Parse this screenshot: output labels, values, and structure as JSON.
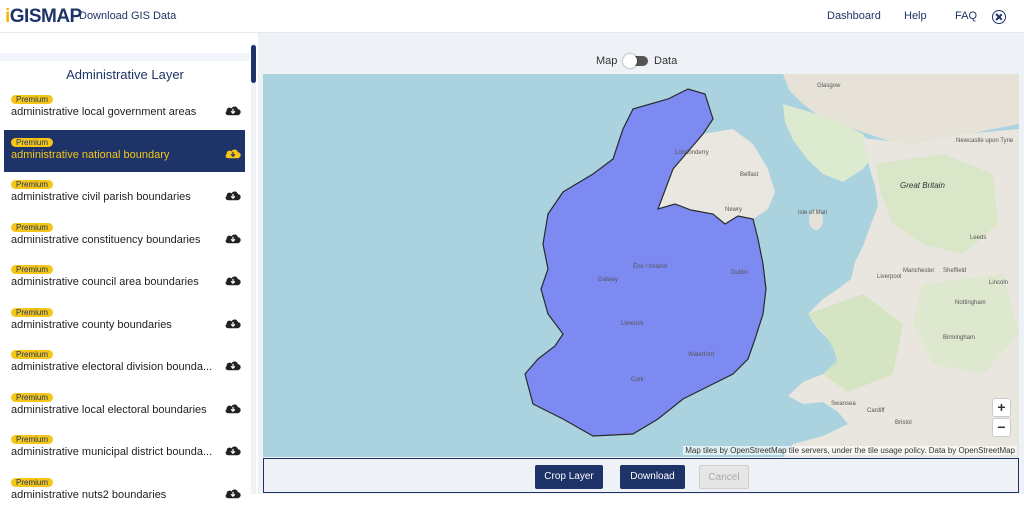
{
  "header": {
    "logo": "GISMAP",
    "title": "Download GIS Data",
    "nav": [
      "Dashboard",
      "Help",
      "FAQ"
    ]
  },
  "sidebar": {
    "heading": "Administrative Layer",
    "badge": "Premium",
    "items": [
      {
        "label": "administrative local government areas",
        "selected": false
      },
      {
        "label": "administrative national boundary",
        "selected": true
      },
      {
        "label": "administrative civil parish boundaries",
        "selected": false
      },
      {
        "label": "administrative constituency boundaries",
        "selected": false
      },
      {
        "label": "administrative council area boundaries",
        "selected": false
      },
      {
        "label": "administrative county boundaries",
        "selected": false
      },
      {
        "label": "administrative electoral division bounda...",
        "selected": false
      },
      {
        "label": "administrative local electoral boundaries",
        "selected": false
      },
      {
        "label": "administrative municipal district bounda...",
        "selected": false
      },
      {
        "label": "administrative nuts2 boundaries",
        "selected": false
      }
    ]
  },
  "toggle": {
    "left": "Map",
    "right": "Data"
  },
  "map": {
    "zoom_in": "+",
    "zoom_out": "−",
    "attribution": "Map tiles by OpenStreetMap tile servers, under the tile usage policy. Data by OpenStreetMap",
    "labels": {
      "great_britain": "Great Britain",
      "eire": "Éire / Ireland",
      "isle_of_man": "Isle of Man",
      "dublin": "Dublin",
      "belfast": "Belfast",
      "glasgow": "Glasgow",
      "newcastle": "Newcastle upon Tyne",
      "leeds": "Leeds",
      "manchester": "Manchester",
      "liverpool": "Liverpool",
      "sheffield": "Sheffield",
      "birmingham": "Birmingham",
      "cardiff": "Cardiff",
      "bristol": "Bristol",
      "nottingham": "Nottingham",
      "lincoln": "Lincoln",
      "swansea": "Swansea",
      "galway": "Galway",
      "limerick": "Limerick",
      "cork": "Cork",
      "waterford": "Waterford",
      "newry": "Newry",
      "derry": "Londonderry"
    }
  },
  "actions": {
    "crop": "Crop Layer",
    "download": "Download",
    "cancel": "Cancel"
  },
  "colors": {
    "brand_navy": "#1e3468",
    "badge_yellow": "#f5c518",
    "highlight_fill": "#7b87f2",
    "sea": "#aad3df"
  }
}
